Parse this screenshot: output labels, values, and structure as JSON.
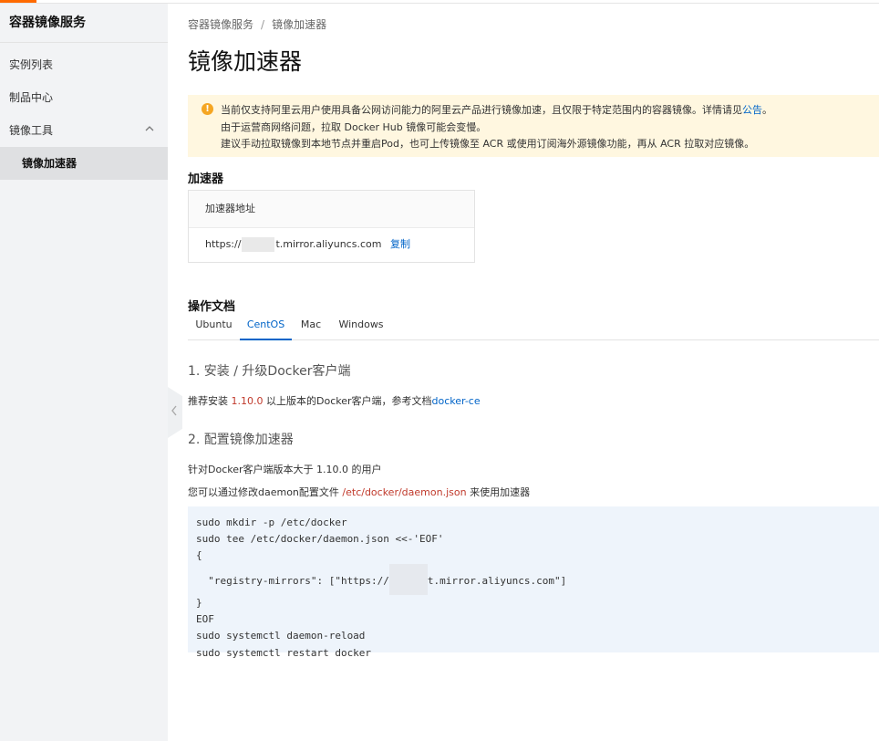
{
  "colors": {
    "brand": "#ff6a00",
    "link": "#0064c8",
    "notice_bg": "#fff7e0",
    "warning": "#f5a623",
    "code_bg": "#eef4fb"
  },
  "sidebar": {
    "title": "容器镜像服务",
    "items": [
      {
        "label": "实例列表"
      },
      {
        "label": "制品中心"
      },
      {
        "label": "镜像工具",
        "icon": "chevron-up-icon"
      },
      {
        "label": "镜像加速器",
        "active": true
      }
    ],
    "collapse_icon": "chevron-left-icon"
  },
  "breadcrumb": {
    "parent": "容器镜像服务",
    "separator": "/",
    "current": "镜像加速器"
  },
  "page": {
    "title": "镜像加速器"
  },
  "notice": {
    "icon": "warning-icon",
    "line1": "当前仅支持阿里云用户使用具备公网访问能力的阿里云产品进行镜像加速，且仅限于特定范围内的容器镜像。详情请见",
    "line1_link": "公告",
    "line1_end": "。",
    "line2": "由于运营商网络问题，拉取 Docker Hub 镜像可能会变慢。",
    "line3": "建议手动拉取镜像到本地节点并重启Pod，也可上传镜像至 ACR 或使用订阅海外源镜像功能，再从 ACR 拉取对应镜像。"
  },
  "accelerator": {
    "section_title": "加速器",
    "column_header": "加速器地址",
    "url_prefix": "https://",
    "url_suffix": "t.mirror.aliyuncs.com",
    "copy_label": "复制"
  },
  "docs": {
    "section_title": "操作文档",
    "tabs": [
      {
        "label": "Ubuntu"
      },
      {
        "label": "CentOS",
        "active": true
      },
      {
        "label": "Mac"
      },
      {
        "label": "Windows"
      }
    ],
    "step1_title": "1. 安装 / 升级Docker客户端",
    "step1_text_a": "推荐安装 ",
    "step1_version": "1.10.0",
    "step1_text_b": " 以上版本的Docker客户端，参考文档",
    "step1_link": "docker-ce",
    "step2_title": "2. 配置镜像加速器",
    "step2_line1": "针对Docker客户端版本大于 1.10.0 的用户",
    "step2_line2_a": "您可以通过修改daemon配置文件 ",
    "step2_path": "/etc/docker/daemon.json",
    "step2_line2_b": " 来使用加速器",
    "code": {
      "l1": "sudo mkdir -p /etc/docker",
      "l2": "sudo tee /etc/docker/daemon.json <<-'EOF'",
      "l3": "{",
      "l4a": "  \"registry-mirrors\": [\"https://",
      "l4b": "t.mirror.aliyuncs.com\"]",
      "l5": "}",
      "l6": "EOF",
      "l7": "sudo systemctl daemon-reload",
      "l8": "sudo systemctl restart docker"
    }
  }
}
